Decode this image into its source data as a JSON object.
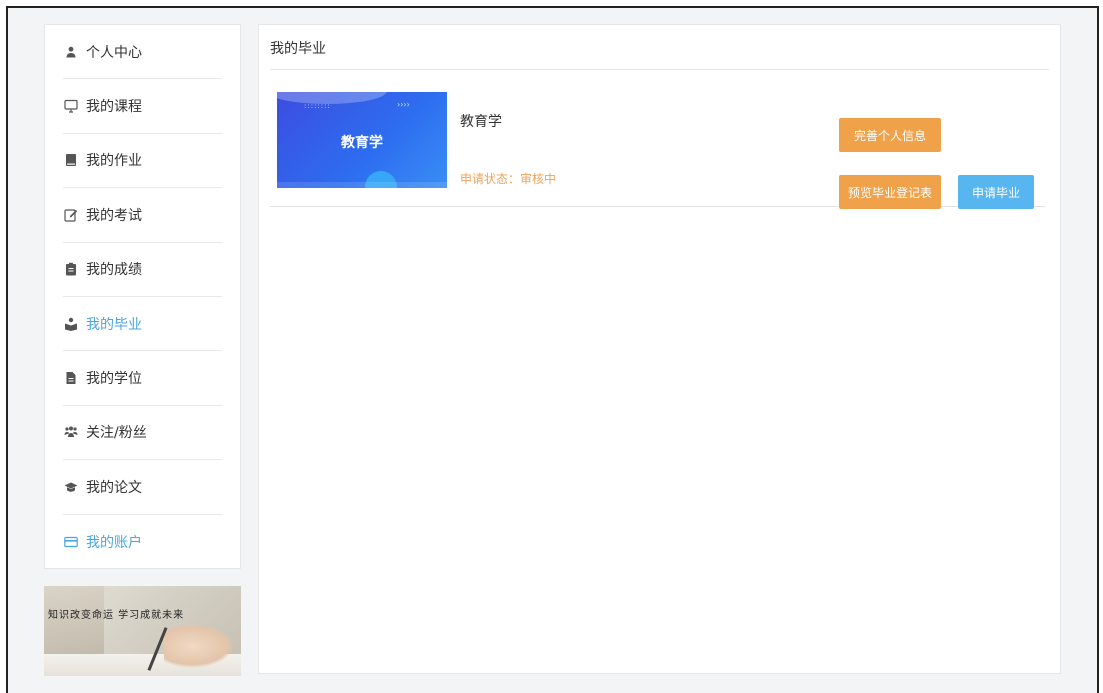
{
  "sidebar": {
    "items": [
      {
        "label": "个人中心",
        "icon": "user-icon",
        "state": "normal"
      },
      {
        "label": "我的课程",
        "icon": "monitor-icon",
        "state": "normal"
      },
      {
        "label": "我的作业",
        "icon": "book-icon",
        "state": "normal"
      },
      {
        "label": "我的考试",
        "icon": "edit-icon",
        "state": "normal"
      },
      {
        "label": "我的成绩",
        "icon": "clipboard-icon",
        "state": "normal"
      },
      {
        "label": "我的毕业",
        "icon": "graduate-reading-icon",
        "state": "active"
      },
      {
        "label": "我的学位",
        "icon": "document-icon",
        "state": "normal"
      },
      {
        "label": "关注/粉丝",
        "icon": "users-icon",
        "state": "normal"
      },
      {
        "label": "我的论文",
        "icon": "graduation-cap-icon",
        "state": "normal"
      },
      {
        "label": "我的账户",
        "icon": "credit-card-icon",
        "state": "accent"
      }
    ]
  },
  "banner": {
    "text": "知识改变命运 学习成就未来"
  },
  "main": {
    "title": "我的毕业",
    "course": {
      "thumbnail_title": "教育学",
      "name": "教育学",
      "status_label": "申请状态：",
      "status_value": "审核中"
    },
    "buttons": {
      "complete_info": "完善个人信息",
      "preview_form": "预览毕业登记表",
      "apply": "申请毕业"
    }
  },
  "colors": {
    "accent_blue": "#4aa6e0",
    "button_orange": "#f0a24b",
    "button_blue": "#57b5f0",
    "status_orange": "#f0a35a"
  }
}
